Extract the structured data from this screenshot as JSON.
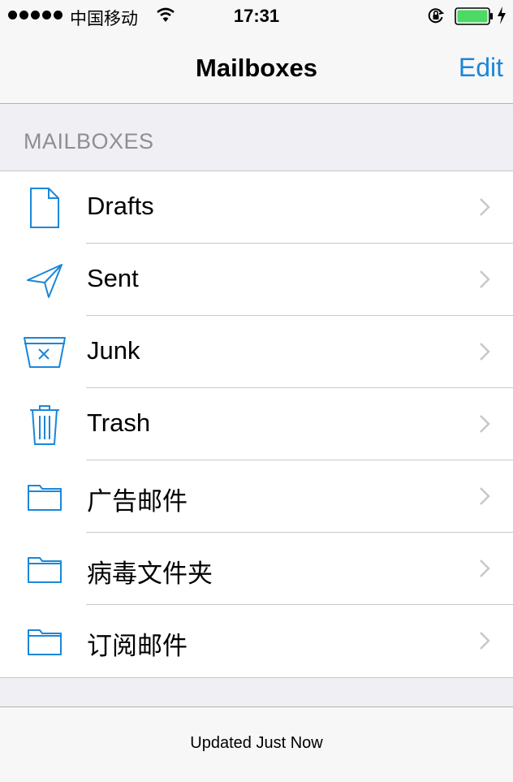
{
  "status_bar": {
    "carrier": "中国移动",
    "time": "17:31"
  },
  "nav": {
    "title": "Mailboxes",
    "edit_label": "Edit"
  },
  "section": {
    "header": "MAILBOXES"
  },
  "mailboxes": [
    {
      "label": "Drafts",
      "icon": "draft-document-icon"
    },
    {
      "label": "Sent",
      "icon": "paper-plane-icon"
    },
    {
      "label": "Junk",
      "icon": "junk-box-icon"
    },
    {
      "label": "Trash",
      "icon": "trash-can-icon"
    },
    {
      "label": "广告邮件",
      "icon": "folder-icon"
    },
    {
      "label": "病毒文件夹",
      "icon": "folder-icon"
    },
    {
      "label": "订阅邮件",
      "icon": "folder-icon"
    }
  ],
  "toolbar": {
    "status": "Updated Just Now"
  },
  "colors": {
    "accent": "#1a87d9",
    "battery": "#4cd964",
    "section_text": "#8e8e93",
    "chevron": "#c7c7cc"
  }
}
